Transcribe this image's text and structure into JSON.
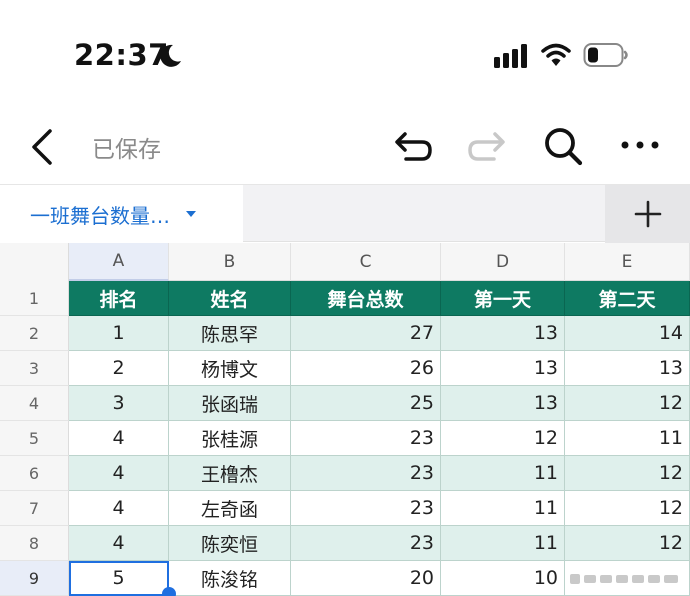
{
  "status_bar": {
    "time": "22:37",
    "icons": [
      "moon-icon",
      "signal-icon",
      "wifi-icon",
      "battery-icon"
    ]
  },
  "nav": {
    "back_icon": "chevron-left-icon",
    "saved_label": "已保存",
    "undo_icon": "undo-icon",
    "redo_icon": "redo-icon",
    "search_icon": "search-icon",
    "more_icon": "more-icon"
  },
  "tabs": {
    "active_sheet": "一班舞台数量…",
    "caret_icon": "caret-down-icon",
    "add_icon": "plus-icon"
  },
  "colors": {
    "header_green": "#0e7a62",
    "row_shade": "#dff0ec",
    "accent_blue": "#1c6fd1",
    "selection_blue": "#1f6fe0"
  },
  "sheet": {
    "columns": [
      "A",
      "B",
      "C",
      "D",
      "E"
    ],
    "row_numbers": [
      "1",
      "2",
      "3",
      "4",
      "5",
      "6",
      "7",
      "8",
      "9"
    ],
    "header": [
      "排名",
      "姓名",
      "舞台总数",
      "第一天",
      "第二天"
    ],
    "rows": [
      [
        "1",
        "陈思罕",
        "27",
        "13",
        "14"
      ],
      [
        "2",
        "杨博文",
        "26",
        "13",
        "13"
      ],
      [
        "3",
        "张函瑞",
        "25",
        "13",
        "12"
      ],
      [
        "4",
        "张桂源",
        "23",
        "12",
        "11"
      ],
      [
        "4",
        "王橹杰",
        "23",
        "11",
        "12"
      ],
      [
        "4",
        "左奇函",
        "23",
        "11",
        "12"
      ],
      [
        "4",
        "陈奕恒",
        "23",
        "11",
        "12"
      ],
      [
        "5",
        "陈浚铭",
        "20",
        "10",
        ""
      ]
    ],
    "selected_cell": "A9"
  }
}
